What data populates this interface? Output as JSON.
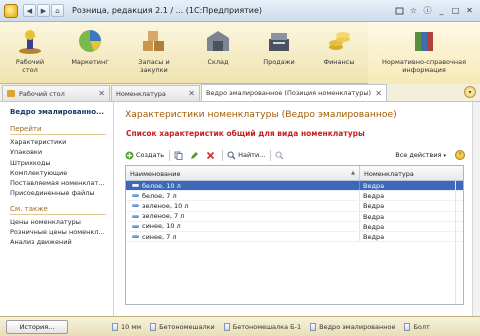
{
  "window": {
    "title": "Розница, редакция 2.1 / ...  (1С:Предприятие)",
    "icons": [
      "app-logo-icon",
      "back-icon",
      "forward-icon",
      "home-icon"
    ],
    "controls": [
      "minimize",
      "maximize",
      "close"
    ]
  },
  "sections": [
    {
      "label": "Рабочий\nстол",
      "icon": "desktop-icon"
    },
    {
      "label": "Маркетинг",
      "icon": "pie-chart-icon"
    },
    {
      "label": "Запасы и\nзакупки",
      "icon": "boxes-icon"
    },
    {
      "label": "Склад",
      "icon": "warehouse-icon"
    },
    {
      "label": "Продажи",
      "icon": "cash-register-icon"
    },
    {
      "label": "Финансы",
      "icon": "coins-icon"
    },
    {
      "label": "Нормативно-справочная\nинформация",
      "icon": "books-icon"
    }
  ],
  "tabs": [
    {
      "label": "Рабочий стол",
      "icon": "desktop-icon"
    },
    {
      "label": "Номенклатура"
    },
    {
      "label": "Ведро эмалированное (Позиция номенклатуры)",
      "active": true
    }
  ],
  "nav": {
    "title": "Ведро эмалированно...",
    "go_group": "Перейти",
    "go_links": [
      "Характеристики",
      "Упаковки",
      "Штрихкоды",
      "Комплектующие",
      "Поставляемая номенклат...",
      "Присоединенные файлы"
    ],
    "see_also_group": "См. также",
    "see_also_links": [
      "Цены номенклатуры",
      "Розничные цены номенкл...",
      "Анализ движений"
    ]
  },
  "main": {
    "title": "Характеристики номенклатуры (Ведро эмалированное)",
    "subtitle": "Список характеристик общий для вида номенклатуры",
    "toolbar": {
      "create": "Создать",
      "find": "Найти...",
      "all_actions": "Все действия"
    },
    "table": {
      "columns": [
        "Наименование",
        "Номенклатура"
      ],
      "rows": [
        {
          "name": "белое, 10 л",
          "item": "Ведра",
          "selected": true
        },
        {
          "name": "белое, 7 л",
          "item": "Ведра"
        },
        {
          "name": "зеленое, 10 л",
          "item": "Ведра"
        },
        {
          "name": "зеленое, 7 л",
          "item": "Ведра"
        },
        {
          "name": "синее, 10 л",
          "item": "Ведра"
        },
        {
          "name": "синее, 7 л",
          "item": "Ведра"
        }
      ]
    }
  },
  "status": {
    "history": "История...",
    "items": [
      "10 мм",
      "Бетономешалки",
      "Бетономешалка Б-1",
      "Ведро эмалированное",
      "Болт"
    ]
  },
  "colors": {
    "accent_title": "#a35c00",
    "subtitle_red": "#c81e1e",
    "selection": "#3d67b7"
  }
}
